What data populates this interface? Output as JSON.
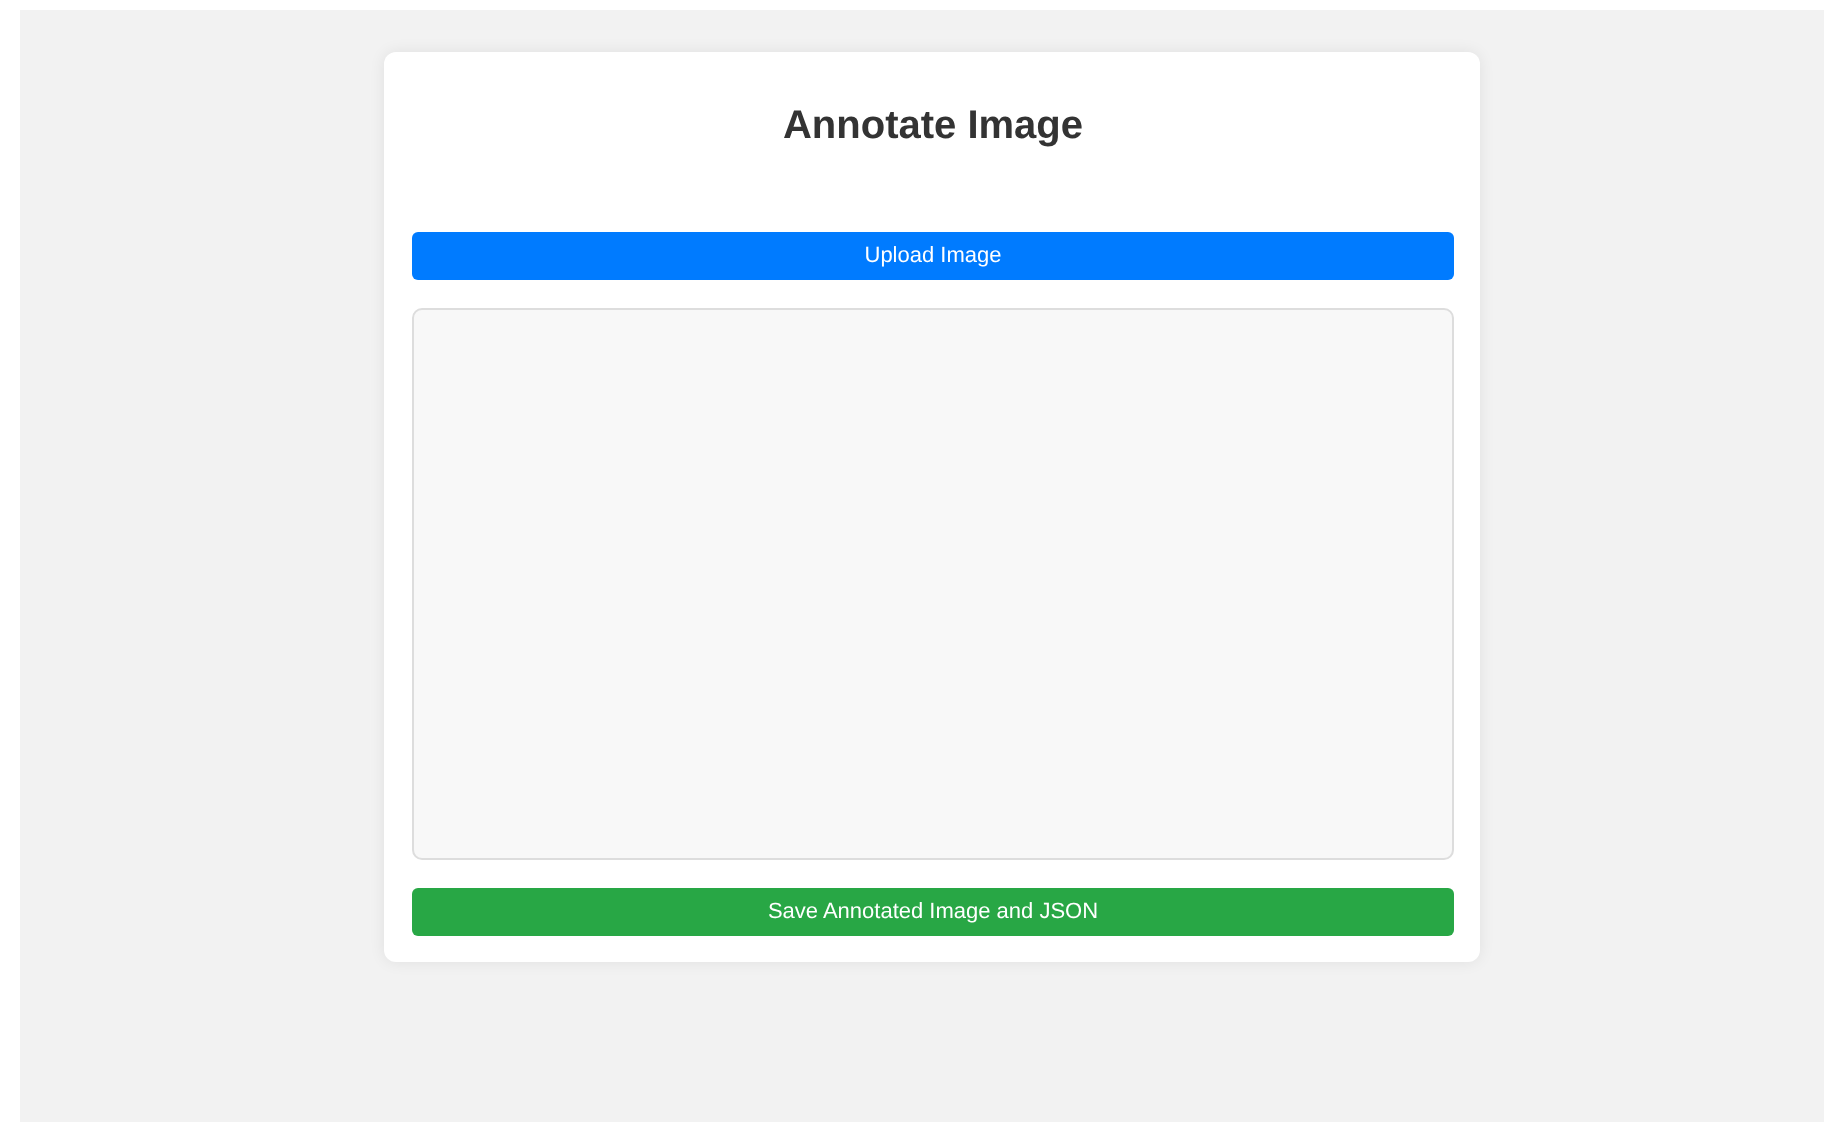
{
  "title": "Annotate Image",
  "upload_button": {
    "label": "Upload Image"
  },
  "save_button": {
    "label": "Save Annotated Image and JSON"
  }
}
